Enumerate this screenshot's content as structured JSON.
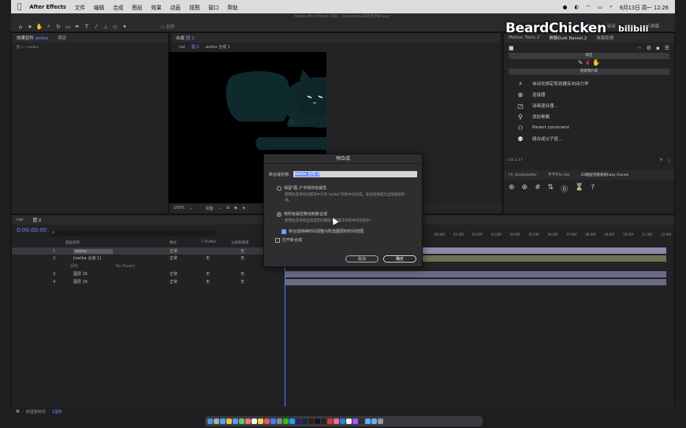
{
  "menubar": {
    "apple": "",
    "app_name": "After Effects",
    "items": [
      "文件",
      "编辑",
      "合成",
      "图层",
      "效果",
      "动画",
      "视图",
      "窗口",
      "帮助"
    ],
    "clock": "6月13日 周一  12:26"
  },
  "window_title": "Adobe After Effects 2022 - /Users/mac/未命名项目.aep *",
  "toolbar": {
    "snap_label": "对齐",
    "workspaces": [
      "默认",
      "审阅",
      "学习",
      "小屏幕"
    ],
    "active_workspace": "默认"
  },
  "left_panel": {
    "tab_effects": "效果控件",
    "tab_effects_target": "weiba",
    "tab_project": "项目",
    "path": "图 1 • weiba"
  },
  "comp_panel": {
    "tab_label": "合成",
    "tab_comp_name": "图 2",
    "breadcrumb": [
      "cat",
      "图 2",
      "weiba 合成 1"
    ],
    "zoom": "100%",
    "quality": "完整"
  },
  "right_panel": {
    "tabs": [
      "Motion Tools 2",
      "骨骼Duik Bassel.2",
      "效果和预"
    ],
    "section_titles": [
      "绑定",
      "链接和约束"
    ],
    "tools": [
      {
        "icon": "auto-rig-icon",
        "label": "自动化绑定和创建反向动力学"
      },
      {
        "icon": "link-icon",
        "label": "连接器"
      },
      {
        "icon": "animation-blend-icon",
        "label": "动画混合器..."
      },
      {
        "icon": "pin-icon",
        "label": "添加骨骼"
      },
      {
        "icon": "parent-icon",
        "label": "Parent constraint"
      },
      {
        "icon": "parent-child-icon",
        "label": "骑合成父子层..."
      }
    ],
    "version": "v16.2.17",
    "bottom_tabs": [
      "FX_StrokeSetter",
      "字节字Scribe",
      "2D图层克隆系统Easy Clones"
    ]
  },
  "timeline": {
    "tabs": [
      "cat",
      "图 2"
    ],
    "timecode": "0:00:00:00",
    "search_placeholder": "ρ",
    "columns": [
      "图层名称",
      "模式",
      "T TrkMat",
      "父级和链接"
    ],
    "layers": [
      {
        "num": "1",
        "name": "weiba",
        "mode": "正常",
        "trkmat": "",
        "parent": "无"
      },
      {
        "num": "2",
        "name": "[weiba 合成 1]",
        "mode": "正常",
        "trkmat": "无",
        "parent": "无"
      },
      {
        "num": "",
        "name": "源标",
        "mode": "",
        "trkmat": "",
        "parent": "No Parent"
      },
      {
        "num": "3",
        "name": "图层 16",
        "mode": "正常",
        "trkmat": "无",
        "parent": "无"
      },
      {
        "num": "4",
        "name": "图层 16",
        "mode": "正常",
        "trkmat": "无",
        "parent": "无"
      }
    ],
    "ruler": [
      "00:00f",
      "01:00f",
      "02:00f",
      "03:00f",
      "04:00f",
      "05:00f",
      "06:00f",
      "07:00f",
      "08:00f",
      "09:00f",
      "10:00f",
      "11:00f",
      "12:00f"
    ],
    "status_label": "帧渲染时间",
    "status_value": "1毫秒"
  },
  "dialog": {
    "title": "预合成",
    "name_label": "新合成名称:",
    "name_value": "weiba 合成 2",
    "option1_label": "保留\"图 2\"中的所有属性",
    "option1_desc": "使用此选项将创建其中只有\"weiba\"的新中间合成。新合成将成为当前图层的源。",
    "option2_label": "将所有属性移动到新合成",
    "option2_desc": "使用此选项将当前选定的图层一起置于新的中间合成中。",
    "check1_label": "将合成持续时间调整为所选图层的时间范围",
    "check2_label": "打开新合成",
    "cancel_label": "取消",
    "ok_label": "确定"
  },
  "watermark": {
    "text": "BeardChicken",
    "logo": "bilibili"
  }
}
